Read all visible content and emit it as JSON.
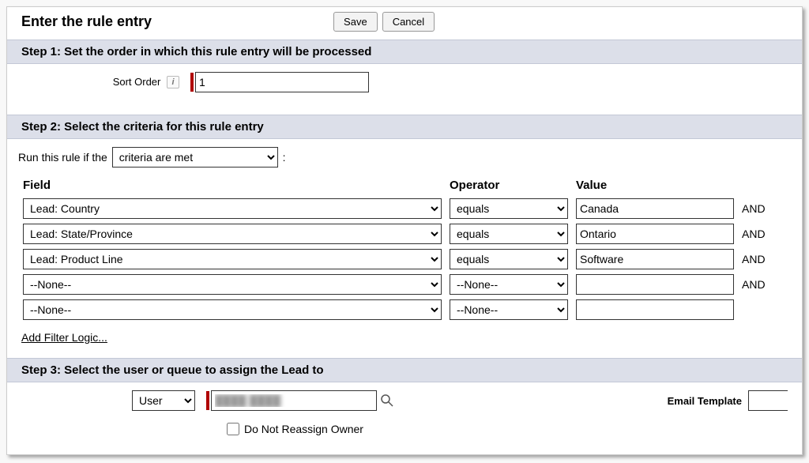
{
  "header": {
    "title": "Enter the rule entry",
    "save": "Save",
    "cancel": "Cancel"
  },
  "step1": {
    "title": "Step 1: Set the order in which this rule entry will be processed",
    "sort_label": "Sort Order",
    "sort_value": "1"
  },
  "step2": {
    "title": "Step 2: Select the criteria for this rule entry",
    "run_prefix": "Run this rule if the",
    "run_mode": "criteria are met",
    "run_suffix": ":",
    "col_field": "Field",
    "col_operator": "Operator",
    "col_value": "Value",
    "and": "AND",
    "rows": [
      {
        "field": "Lead: Country",
        "operator": "equals",
        "value": "Canada"
      },
      {
        "field": "Lead: State/Province",
        "operator": "equals",
        "value": "Ontario"
      },
      {
        "field": "Lead: Product Line",
        "operator": "equals",
        "value": "Software"
      },
      {
        "field": "--None--",
        "operator": "--None--",
        "value": ""
      },
      {
        "field": "--None--",
        "operator": "--None--",
        "value": ""
      }
    ],
    "add_filter": "Add Filter Logic..."
  },
  "step3": {
    "title": "Step 3: Select the user or queue to assign the Lead to",
    "assign_type": "User",
    "assign_value": "████ ████",
    "do_not_reassign": "Do Not Reassign Owner",
    "email_template_label": "Email Template",
    "email_template_value": ""
  }
}
